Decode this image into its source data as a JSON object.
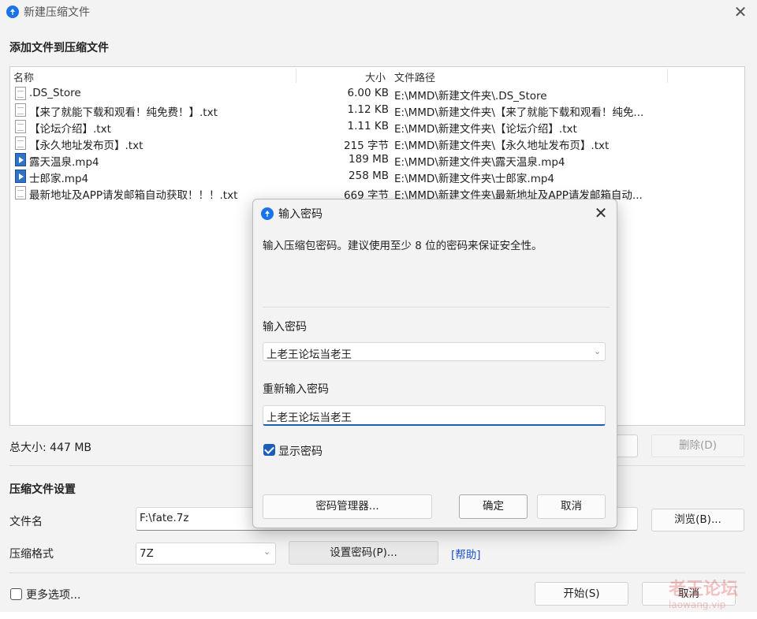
{
  "window": {
    "title": "新建压缩文件",
    "add_files_title": "添加文件到压缩文件"
  },
  "file_list": {
    "columns": {
      "name": "名称",
      "size": "大小",
      "path": "文件路径"
    },
    "rows": [
      {
        "icon": "text-file-icon",
        "name": ".DS_Store",
        "size": "6.00 KB",
        "path": "E:\\MMD\\新建文件夹\\.DS_Store"
      },
      {
        "icon": "text-file-icon",
        "name": "【来了就能下载和观看！纯免费！】.txt",
        "size": "1.12 KB",
        "path": "E:\\MMD\\新建文件夹\\【来了就能下载和观看！纯免..."
      },
      {
        "icon": "text-file-icon",
        "name": "【论坛介绍】.txt",
        "size": "1.11 KB",
        "path": "E:\\MMD\\新建文件夹\\【论坛介绍】.txt"
      },
      {
        "icon": "text-file-icon",
        "name": "【永久地址发布页】.txt",
        "size": "215 字节",
        "path": "E:\\MMD\\新建文件夹\\【永久地址发布页】.txt"
      },
      {
        "icon": "video-file-icon",
        "name": "露天温泉.mp4",
        "size": "189 MB",
        "path": "E:\\MMD\\新建文件夹\\露天温泉.mp4"
      },
      {
        "icon": "video-file-icon",
        "name": "士郎家.mp4",
        "size": "258 MB",
        "path": "E:\\MMD\\新建文件夹\\士郎家.mp4"
      },
      {
        "icon": "text-file-icon",
        "name": "最新地址及APP请发邮箱自动获取！！！.txt",
        "size": "669 字节",
        "path": "E:\\MMD\\新建文件夹\\最新地址及APP请发邮箱自动..."
      }
    ]
  },
  "summary": {
    "total_size": "总大小: 447 MB",
    "delete_label": "删除(D)"
  },
  "settings": {
    "title": "压缩文件设置",
    "filename_label": "文件名",
    "filename_value": "F:\\fate.7z",
    "browse_label": "浏览(B)...",
    "format_label": "压缩格式",
    "format_value": "7Z",
    "set_password_label": "设置密码(P)...",
    "help_label": "[帮助]",
    "more_options_label": "更多选项...",
    "start_label": "开始(S)",
    "cancel_label": "取消"
  },
  "password_dialog": {
    "title": "输入密码",
    "description": "输入压缩包密码。建议使用至少 8 位的密码来保证安全性。",
    "password_label": "输入密码",
    "password_value": "上老王论坛当老王",
    "reenter_label": "重新输入密码",
    "reenter_value": "上老王论坛当老王",
    "show_password_label": "显示密码",
    "show_password_checked": true,
    "manager_label": "密码管理器...",
    "ok_label": "确定",
    "cancel_label": "取消"
  },
  "watermark": {
    "line1": "老王论坛",
    "line2": "laowang.vip"
  },
  "colors": {
    "accent": "#1b5fb8",
    "link": "#1a4fd6"
  }
}
